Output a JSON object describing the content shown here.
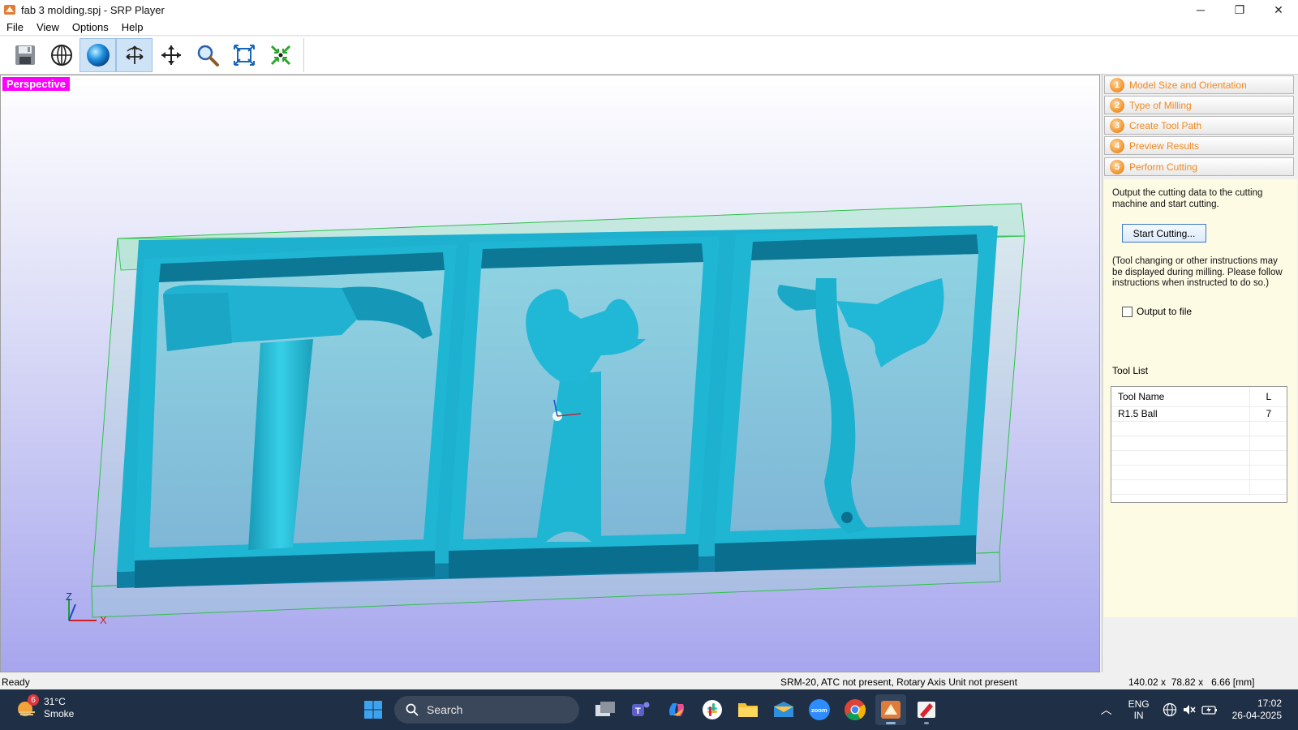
{
  "window": {
    "title": "fab 3 molding.spj - SRP Player",
    "minimize": "─",
    "restore": "❐",
    "close": "✕"
  },
  "menu": [
    "File",
    "View",
    "Options",
    "Help"
  ],
  "toolbar": {
    "tools": [
      "save-icon",
      "globe-icon",
      "sphere-icon",
      "rotate-icon",
      "move-icon",
      "zoom-icon",
      "fit-icon",
      "center-icon"
    ],
    "active": [
      "sphere-icon",
      "rotate-icon"
    ]
  },
  "viewport": {
    "label": "Perspective",
    "axis_z": "Z",
    "axis_x": "X"
  },
  "steps": [
    {
      "num": "1",
      "label": "Model Size and Orientation"
    },
    {
      "num": "2",
      "label": "Type of Milling"
    },
    {
      "num": "3",
      "label": "Create Tool Path"
    },
    {
      "num": "4",
      "label": "Preview Results"
    },
    {
      "num": "5",
      "label": "Perform Cutting"
    }
  ],
  "perform_cutting": {
    "description": "Output the cutting data to the cutting machine and start cutting.",
    "start_button": "Start Cutting...",
    "note": "(Tool changing or other instructions may be displayed during milling. Please follow instructions when instructed to do so.)",
    "output_to_file": "Output to file",
    "output_to_file_checked": false,
    "tool_list_title": "Tool List",
    "tool_list": {
      "headers": [
        "Tool Name",
        "L"
      ],
      "rows": [
        [
          "R1.5 Ball",
          "7"
        ]
      ]
    }
  },
  "status": {
    "left": "Ready",
    "machine": "SRM-20, ATC not present, Rotary Axis Unit not present",
    "size": "140.02 x  78.82 x   6.66 [mm]"
  },
  "taskbar": {
    "weather_temp": "31°C",
    "weather_desc": "Smoke",
    "weather_badge": "6",
    "search_placeholder": "Search",
    "lang_top": "ENG",
    "lang_bottom": "IN",
    "time": "17:02",
    "date": "26-04-2025"
  },
  "colors": {
    "model": "#1fb3cf",
    "perspective_label": "#ff00ff",
    "step_text": "#f08a22"
  }
}
